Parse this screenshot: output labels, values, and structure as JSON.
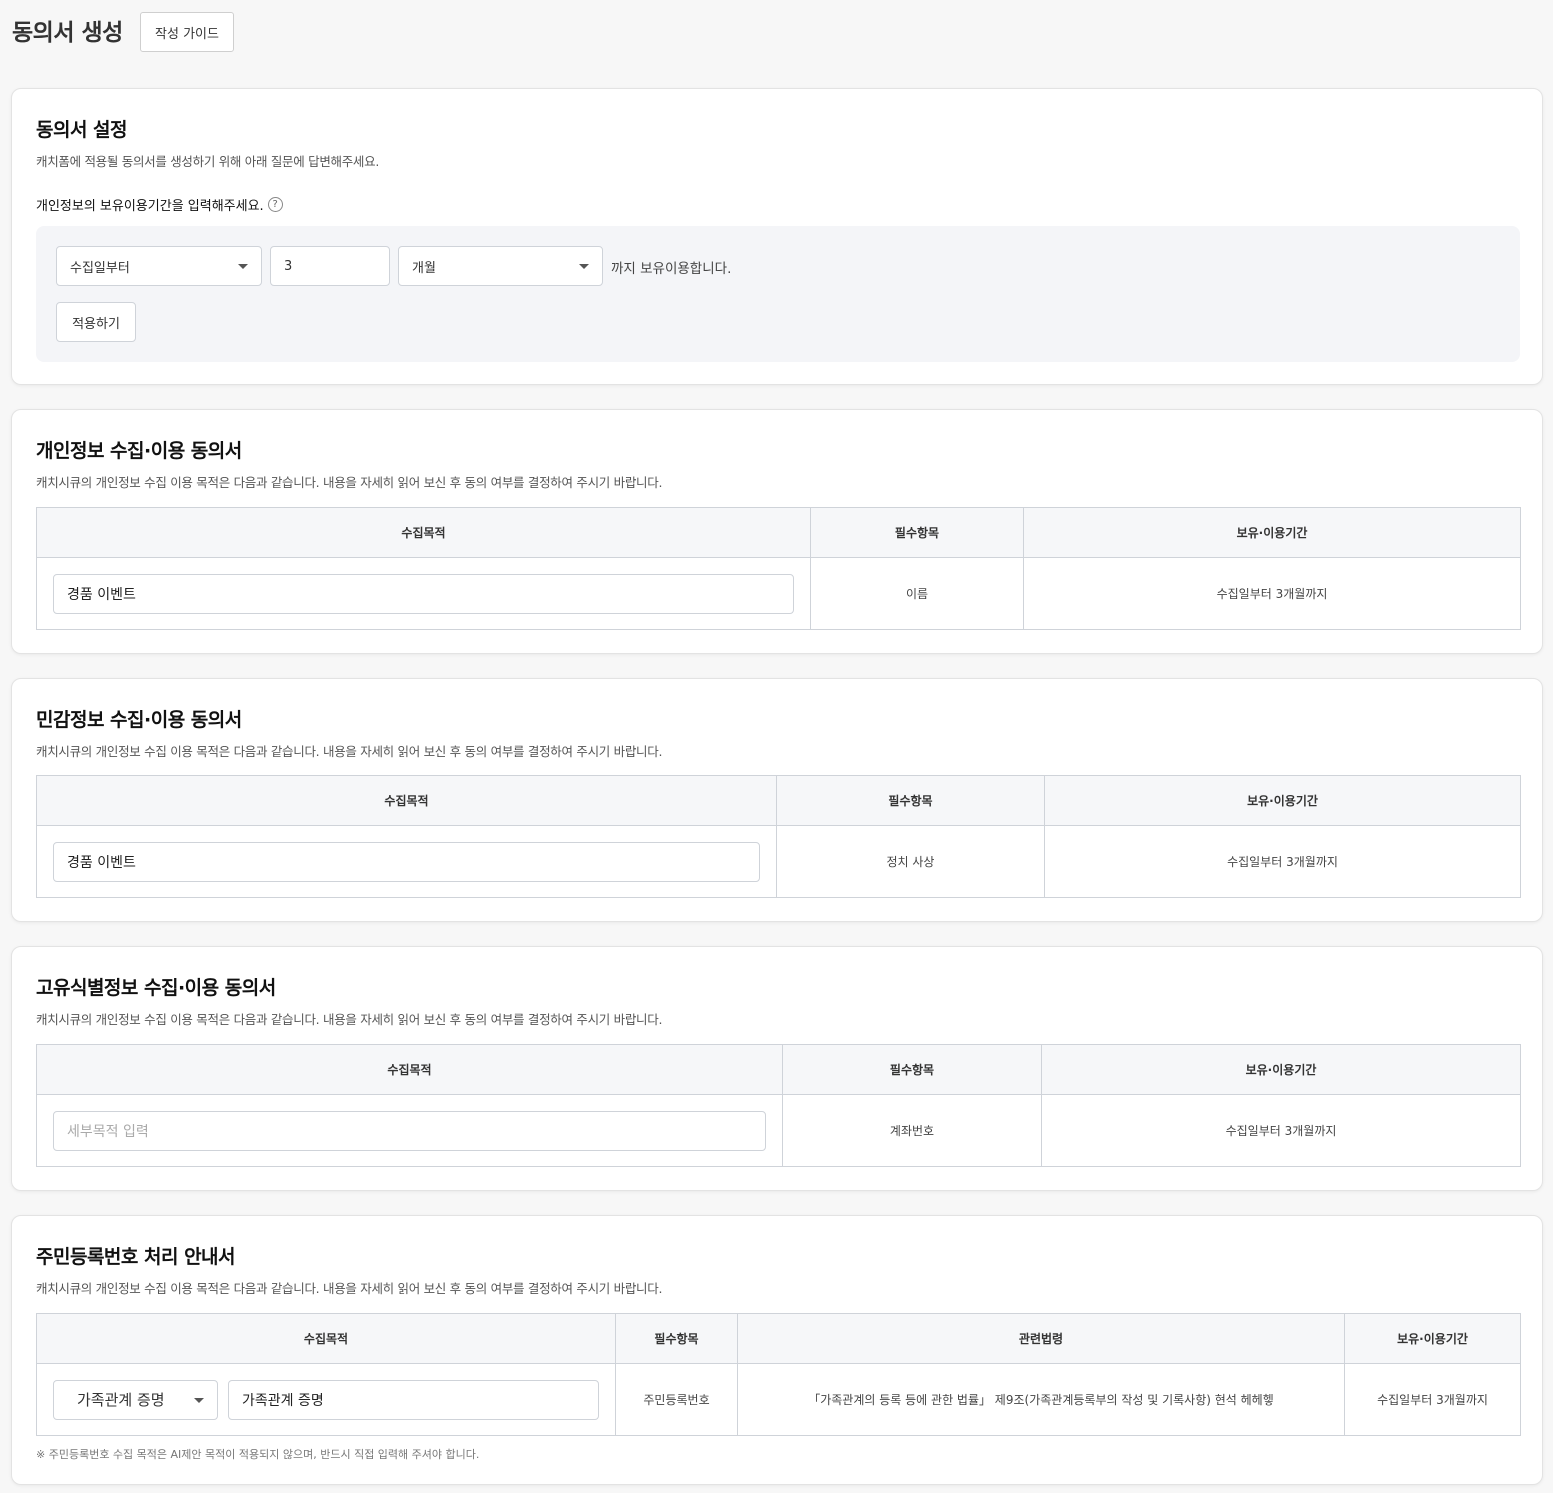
{
  "header": {
    "title": "동의서 생성",
    "guide_button": "작성 가이드"
  },
  "settings": {
    "title": "동의서 설정",
    "description": "캐치폼에 적용될 동의서를 생성하기 위해 아래 질문에 답변해주세요.",
    "question": "개인정보의 보유이용기간을 입력해주세요.",
    "start_select": "수집일부터",
    "period_value": "3",
    "unit_select": "개월",
    "suffix_text": "까지 보유이용합니다.",
    "apply_button": "적용하기"
  },
  "sections": [
    {
      "title": "개인정보 수집·이용 동의서",
      "description": "캐치시큐의 개인정보 수집 이용 목적은 다음과 같습니다. 내용을 자세히 읽어 보신 후 동의 여부를 결정하여 주시기 바랍니다.",
      "headers": [
        "수집목적",
        "필수항목",
        "보유·이용기간"
      ],
      "purpose_value": "경품 이벤트",
      "required_item": "이름",
      "retention": "수집일부터 3개월까지"
    },
    {
      "title": "민감정보 수집·이용 동의서",
      "description": "캐치시큐의 개인정보 수집 이용 목적은 다음과 같습니다. 내용을 자세히 읽어 보신 후 동의 여부를 결정하여 주시기 바랍니다.",
      "headers": [
        "수집목적",
        "필수항목",
        "보유·이용기간"
      ],
      "purpose_value": "경품 이벤트",
      "required_item": "정치 사상",
      "retention": "수집일부터 3개월까지"
    },
    {
      "title": "고유식별정보 수집·이용 동의서",
      "description": "캐치시큐의 개인정보 수집 이용 목적은 다음과 같습니다. 내용을 자세히 읽어 보신 후 동의 여부를 결정하여 주시기 바랍니다.",
      "headers": [
        "수집목적",
        "필수항목",
        "보유·이용기간"
      ],
      "purpose_placeholder": "세부목적 입력",
      "required_item": "계좌번호",
      "retention": "수집일부터 3개월까지"
    },
    {
      "title": "주민등록번호 처리 안내서",
      "description": "캐치시큐의 개인정보 수집 이용 목적은 다음과 같습니다. 내용을 자세히 읽어 보신 후 동의 여부를 결정하여 주시기 바랍니다.",
      "headers": [
        "수집목적",
        "필수항목",
        "관련법령",
        "보유·이용기간"
      ],
      "purpose_select": "가족관계 증명",
      "purpose_value": "가족관계 증명",
      "required_item": "주민등록번호",
      "law": "「가족관계의 등록 등에 관한 법률」 제9조(가족관계등록부의 작성 및 기록사항) 현석 헤헤헿",
      "retention": "수집일부터 3개월까지",
      "note": "※ 주민등록번호 수집 목적은 AI제안 목적이 적용되지 않으며, 반드시 직접 입력해 주셔야 합니다."
    }
  ]
}
